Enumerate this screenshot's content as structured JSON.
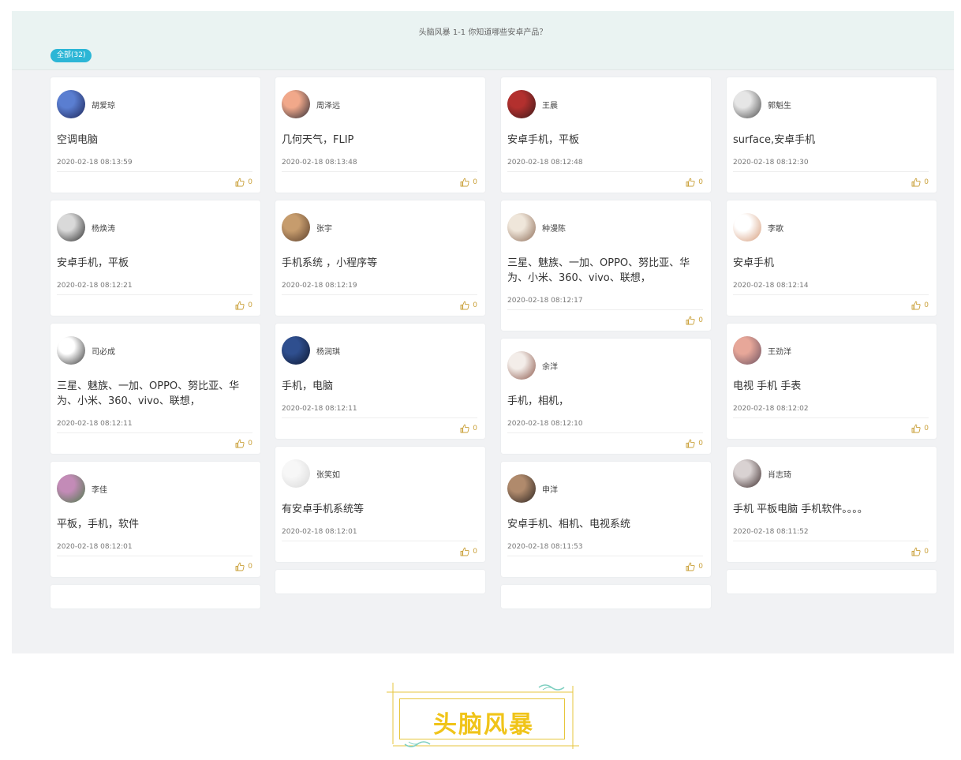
{
  "board": {
    "title": "头脑风暴 1-1 你知道哪些安卓产品？",
    "filter_tab": "全部(32)"
  },
  "columns": [
    [
      {
        "author": "胡爱琼",
        "content": "空调电脑",
        "time": "2020-02-18 08:13:59",
        "likes": "0",
        "avatar_colors": [
          "#5a7ed1",
          "#1c2456"
        ]
      },
      {
        "author": "杨焕涛",
        "content": "安卓手机，平板",
        "time": "2020-02-18 08:12:21",
        "likes": "0",
        "avatar_colors": [
          "#d9d9d9",
          "#2a2a2a"
        ]
      },
      {
        "author": "司必成",
        "content": "三星、魅族、一加、OPPO、努比亚、华为、小米、360、vivo、联想，",
        "time": "2020-02-18 08:12:11",
        "likes": "0",
        "avatar_colors": [
          "#ffffff",
          "#333333"
        ]
      },
      {
        "author": "李佳",
        "content": "平板，手机，软件",
        "time": "2020-02-18 08:12:01",
        "likes": "0",
        "avatar_colors": [
          "#c38bb7",
          "#4c7a4a"
        ]
      }
    ],
    [
      {
        "author": "周泽远",
        "content": "几何天气，FLIP",
        "time": "2020-02-18 08:13:48",
        "likes": "0",
        "avatar_colors": [
          "#f1a88a",
          "#2b2b35"
        ]
      },
      {
        "author": "张宇",
        "content": "手机系统   ，小程序等",
        "time": "2020-02-18 08:12:19",
        "likes": "0",
        "avatar_colors": [
          "#c69c6d",
          "#5a3e2b"
        ]
      },
      {
        "author": "杨润琪",
        "content": "手机，电脑",
        "time": "2020-02-18 08:12:11",
        "likes": "0",
        "avatar_colors": [
          "#2f4f8f",
          "#0d1730"
        ]
      },
      {
        "author": "张笑如",
        "content": "有安卓手机系统等",
        "time": "2020-02-18 08:12:01",
        "likes": "0",
        "avatar_colors": [
          "#f7f7f7",
          "#d8d8d8"
        ]
      }
    ],
    [
      {
        "author": "王晨",
        "content": "安卓手机，平板",
        "time": "2020-02-18 08:12:48",
        "likes": "0",
        "avatar_colors": [
          "#b3302e",
          "#3a1a1a"
        ]
      },
      {
        "author": "种漫陈",
        "content": "三星、魅族、一加、OPPO、努比亚、华为、小米、360、vivo、联想，",
        "time": "2020-02-18 08:12:17",
        "likes": "0",
        "avatar_colors": [
          "#efe6da",
          "#8c6a55"
        ]
      },
      {
        "author": "余洋",
        "content": "手机，相机，",
        "time": "2020-02-18 08:12:10",
        "likes": "0",
        "avatar_colors": [
          "#f3ede9",
          "#8a5548"
        ]
      },
      {
        "author": "申洋",
        "content": "安卓手机、相机、电视系统",
        "time": "2020-02-18 08:11:53",
        "likes": "0",
        "avatar_colors": [
          "#b08a6c",
          "#2a2320"
        ]
      }
    ],
    [
      {
        "author": "郭魁生",
        "content": "surface,安卓手机",
        "time": "2020-02-18 08:12:30",
        "likes": "0",
        "avatar_colors": [
          "#e6e6e6",
          "#4a4a4a"
        ]
      },
      {
        "author": "李歌",
        "content": "安卓手机",
        "time": "2020-02-18 08:12:14",
        "likes": "0",
        "avatar_colors": [
          "#ffffff",
          "#d59a77"
        ]
      },
      {
        "author": "王劲洋",
        "content": "电视  手机   手表",
        "time": "2020-02-18 08:12:02",
        "likes": "0",
        "avatar_colors": [
          "#e7a799",
          "#6a5060"
        ]
      },
      {
        "author": "肖志琦",
        "content": "手机 平板电脑  手机软件。。。。",
        "time": "2020-02-18 08:11:52",
        "likes": "0",
        "avatar_colors": [
          "#d9d2d2",
          "#3b2a2a"
        ]
      }
    ]
  ],
  "footer_badge": "头脑风暴",
  "colors": {
    "accent": "#2cb6d6",
    "like": "#caa13a",
    "badge": "#f0c419",
    "badge_line": "#7ecfc0"
  }
}
